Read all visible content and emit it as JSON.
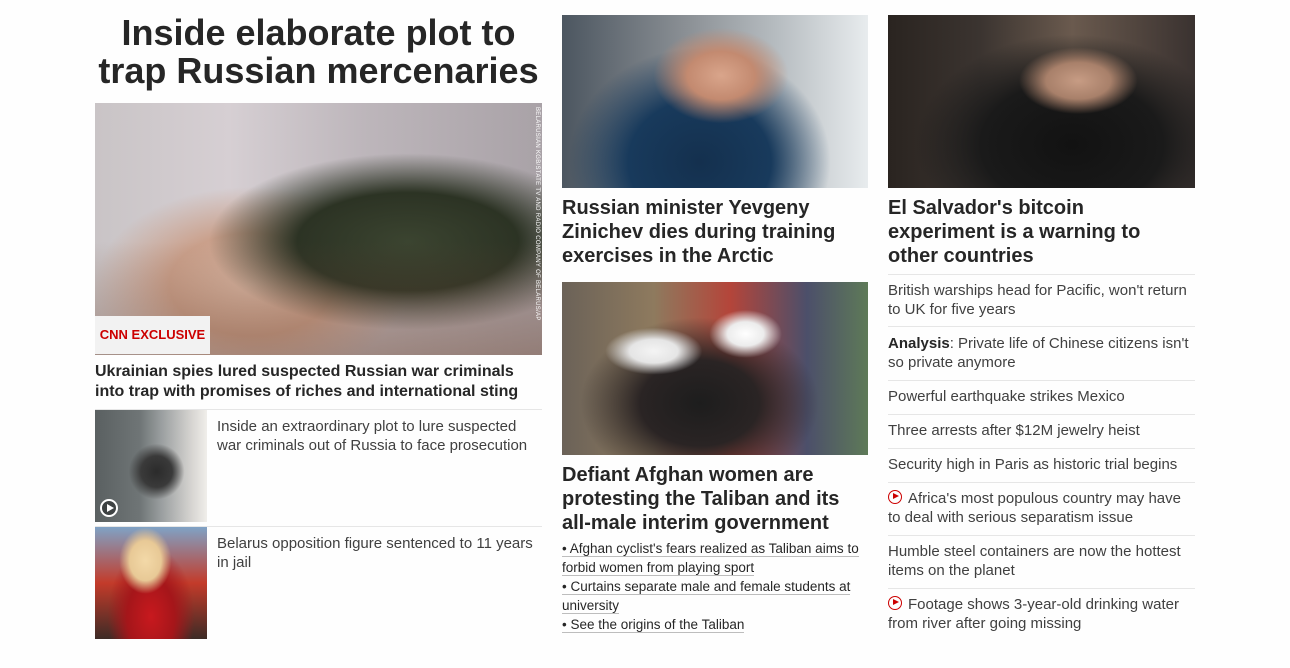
{
  "column_left": {
    "title": "Inside elaborate plot to trap Russian mercenaries",
    "hero_credit": "BELARUSIAN KGB/STATE TV AND RADIO COMPANY OF BELARUS/AP",
    "badge": "CNN EXCLUSIVE",
    "hero_headline": "Ukrainian spies lured suspected Russian war criminals into trap with promises of riches and international sting",
    "stories": [
      {
        "text": "Inside an extraordinary plot to lure suspected war criminals out of Russia to face prosecution",
        "has_video": true
      },
      {
        "text": "Belarus opposition figure sentenced to 11 years in jail",
        "has_video": false
      }
    ]
  },
  "column_middle": {
    "minister_headline": "Russian minister Yevgeny Zinichev dies during training exercises in the Arctic",
    "afghan_headline": "Defiant Afghan women are protesting the Taliban and its all-male interim government",
    "bullets": [
      "• Afghan cyclist's fears realized as Taliban aims to forbid women from playing sport",
      "• Curtains separate male and female students at university",
      "• See the origins of the Taliban"
    ]
  },
  "column_right": {
    "bitcoin_headline": "El Salvador's bitcoin experiment is a warning to other countries",
    "links": [
      {
        "prefix": "",
        "text": "British warships head for Pacific, won't return to UK for five years",
        "video": false
      },
      {
        "prefix": "Analysis",
        "text": ": Private life of Chinese citizens isn't so private anymore",
        "video": false
      },
      {
        "prefix": "",
        "text": "Powerful earthquake strikes Mexico",
        "video": false
      },
      {
        "prefix": "",
        "text": "Three arrests after $12M jewelry heist",
        "video": false
      },
      {
        "prefix": "",
        "text": "Security high in Paris as historic trial begins",
        "video": false
      },
      {
        "prefix": "",
        "text": "Africa's most populous country may have to deal with serious separatism issue",
        "video": true
      },
      {
        "prefix": "",
        "text": "Humble steel containers are now the hottest items on the planet",
        "video": false
      },
      {
        "prefix": "",
        "text": "Footage shows 3-year-old drinking water from river after going missing",
        "video": true
      }
    ]
  },
  "colors": {
    "accent_red": "#cc0000",
    "headline_text": "#262626",
    "body_text": "#404040",
    "divider": "#e6e6e6"
  },
  "icons": {
    "video_play": "play-circle-icon"
  }
}
